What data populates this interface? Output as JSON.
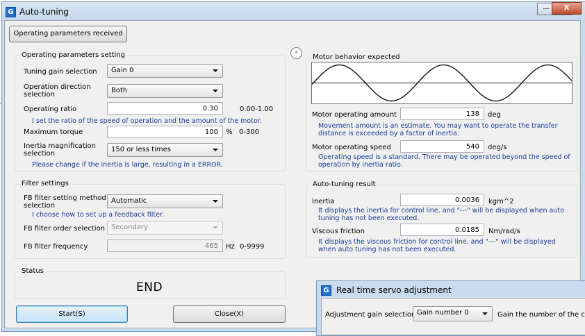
{
  "background_window_title": "Auto-tuning",
  "window": {
    "title": "Auto-tuning",
    "minimize_symbol": "—",
    "maximize_symbol": "▢",
    "close_symbol": "X"
  },
  "received_button": "Operating parameters received",
  "operating": {
    "legend": "Operating parameters setting",
    "tuning_gain_label": "Tuning gain selection",
    "tuning_gain_value": "Gain 0",
    "direction_label": "Operation direction selection",
    "direction_value": "Both",
    "ratio_label": "Operating ratio",
    "ratio_value": "0.30",
    "ratio_range": "0.00-1.00",
    "ratio_note": "I set the ratio of the speed of operation and the amount of the motor.",
    "torque_label": "Maximum torque",
    "torque_value": "100",
    "torque_unit": "%",
    "torque_range": "0-300",
    "inertia_label": "Inertia magnification selection",
    "inertia_value": "150 or less times",
    "inertia_note": "Please change if the inertia is large, resulting in a ERROR."
  },
  "filter": {
    "legend": "Filter settings",
    "method_label": "FB filter setting method selection",
    "method_value": "Automatic",
    "method_note": "I choose how to set up a feedback filter.",
    "order_label": "FB filter order selection",
    "order_value": "Secondary",
    "frequency_label": "FB filter frequency",
    "frequency_value": "465",
    "frequency_unit": "Hz",
    "frequency_range": "0-9999"
  },
  "status": {
    "legend": "Status",
    "value": "END"
  },
  "start_button": "Start(S)",
  "close_button": "Close(X)",
  "collapse_icon": "chevron-left-icon",
  "collapse_glyph": "‹",
  "motor": {
    "legend": "Motor behavior expected",
    "amount_label": "Motor operating amount",
    "amount_value": "138",
    "amount_unit": "deg",
    "amount_note": "Movement amount is an estimate. You may want to operate the transfer distance is exceeded by a factor of inertia.",
    "speed_label": "Motor operating speed",
    "speed_value": "540",
    "speed_unit": "deg/s",
    "speed_note": "Operating speed is a standard. There may be operated beyond the speed of operation by inertia ratio."
  },
  "result": {
    "legend": "Auto-tuning result",
    "inertia_label": "Inertia",
    "inertia_value": "0.0036",
    "inertia_unit": "kgm^2",
    "inertia_note": "It displays the inertia for control line, and \"---\" will be displayed when auto tuning has not been executed.",
    "friction_label": "Viscous friction",
    "friction_value": "0.0185",
    "friction_unit": "Nm/rad/s",
    "friction_note": "It displays the viscous friction for control line, and \"---\" will be displayed when auto tuning has not been executed."
  },
  "realtime_window": {
    "title": "Real time servo adjustment",
    "gain_label": "Adjustment gain selection",
    "gain_value": "Gain number 0",
    "gain_note": "Gain the number of the cu"
  },
  "colors": {
    "note_text": "#1a3d9c",
    "title_bar": "#c9dbee",
    "app_icon": "#1f6fd0",
    "close_button": "#c04a2c"
  }
}
